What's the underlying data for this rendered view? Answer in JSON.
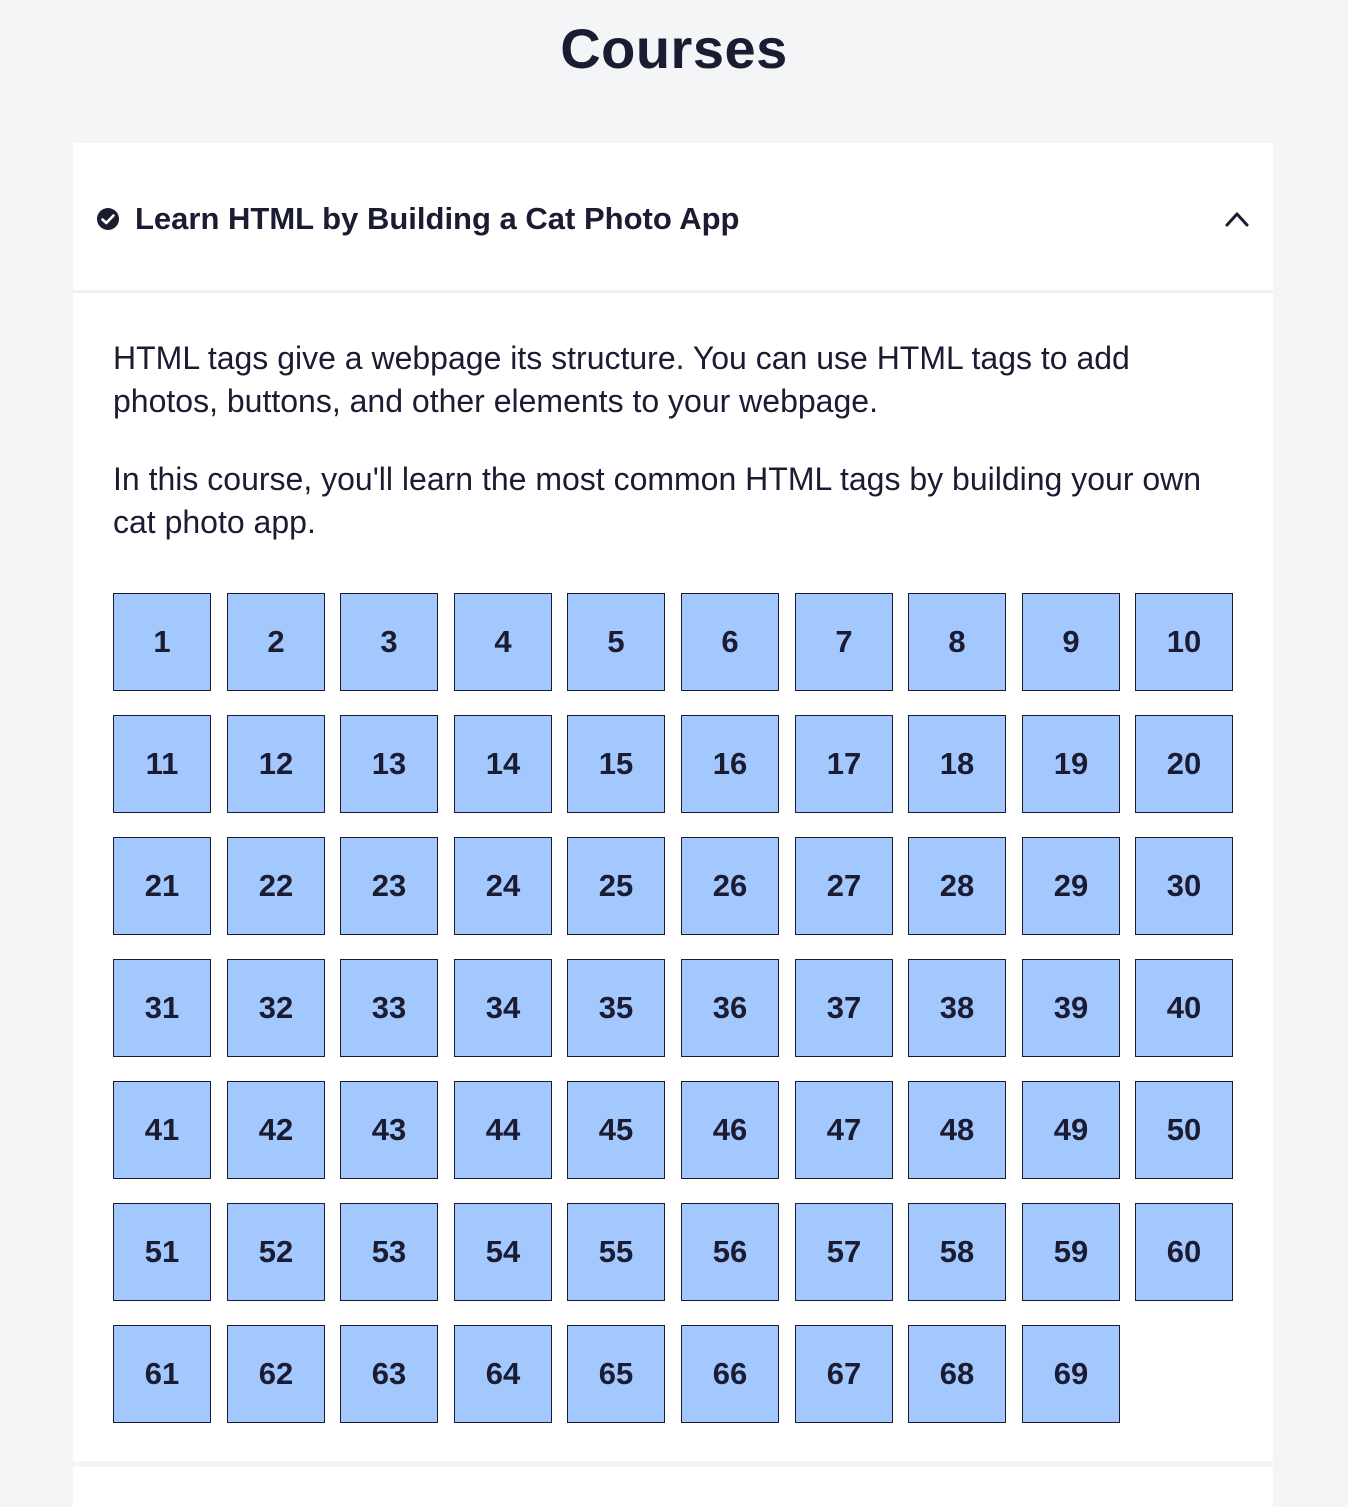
{
  "page": {
    "title": "Courses"
  },
  "course": {
    "status_icon": "check-circle-icon",
    "title": "Learn HTML by Building a Cat Photo App",
    "toggle_icon": "chevron-up-icon",
    "description": [
      "HTML tags give a webpage its structure. You can use HTML tags to add photos, buttons, and other elements to your webpage.",
      "In this course, you'll learn the most common HTML tags by building your own cat photo app."
    ],
    "steps": [
      "1",
      "2",
      "3",
      "4",
      "5",
      "6",
      "7",
      "8",
      "9",
      "10",
      "11",
      "12",
      "13",
      "14",
      "15",
      "16",
      "17",
      "18",
      "19",
      "20",
      "21",
      "22",
      "23",
      "24",
      "25",
      "26",
      "27",
      "28",
      "29",
      "30",
      "31",
      "32",
      "33",
      "34",
      "35",
      "36",
      "37",
      "38",
      "39",
      "40",
      "41",
      "42",
      "43",
      "44",
      "45",
      "46",
      "47",
      "48",
      "49",
      "50",
      "51",
      "52",
      "53",
      "54",
      "55",
      "56",
      "57",
      "58",
      "59",
      "60",
      "61",
      "62",
      "63",
      "64",
      "65",
      "66",
      "67",
      "68",
      "69"
    ]
  },
  "colors": {
    "page_background": "#f4f5f7",
    "card_background": "#ffffff",
    "step_fill": "#a3c8fd",
    "text": "#1b1b32"
  }
}
